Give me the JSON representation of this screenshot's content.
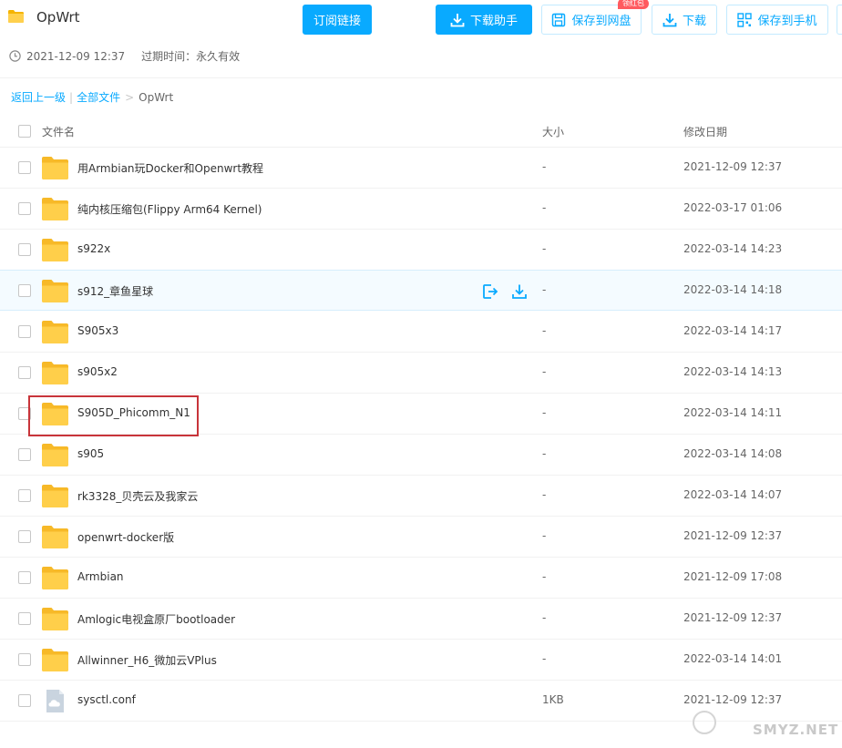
{
  "header": {
    "title": "OpWrt",
    "subscribe_label": "订阅链接",
    "download_helper_label": "下载助手",
    "save_netdisk_label": "保存到网盘",
    "red_packet_badge": "领红包",
    "download_label": "下载",
    "save_phone_label": "保存到手机"
  },
  "meta": {
    "created": "2021-12-09 12:37",
    "expire_label": "过期时间：",
    "expire_value": "永久有效"
  },
  "breadcrumb": {
    "back": "返回上一级",
    "all_files": "全部文件",
    "separator": ">",
    "current": "OpWrt"
  },
  "table": {
    "col_name": "文件名",
    "col_size": "大小",
    "col_date": "修改日期",
    "rows": [
      {
        "name": "用Armbian玩Docker和Openwrt教程",
        "size": "-",
        "date": "2021-12-09 12:37"
      },
      {
        "name": "纯内核压缩包(Flippy Arm64 Kernel)",
        "size": "-",
        "date": "2022-03-17 01:06"
      },
      {
        "name": "s922x",
        "size": "-",
        "date": "2022-03-14 14:23"
      },
      {
        "name": "s912_章鱼星球",
        "size": "-",
        "date": "2022-03-14 14:18"
      },
      {
        "name": "S905x3",
        "size": "-",
        "date": "2022-03-14 14:17"
      },
      {
        "name": "s905x2",
        "size": "-",
        "date": "2022-03-14 14:13"
      },
      {
        "name": "S905D_Phicomm_N1",
        "size": "-",
        "date": "2022-03-14 14:11"
      },
      {
        "name": "s905",
        "size": "-",
        "date": "2022-03-14 14:08"
      },
      {
        "name": "rk3328_贝壳云及我家云",
        "size": "-",
        "date": "2022-03-14 14:07"
      },
      {
        "name": "openwrt-docker版",
        "size": "-",
        "date": "2021-12-09 12:37"
      },
      {
        "name": "Armbian",
        "size": "-",
        "date": "2021-12-09 17:08"
      },
      {
        "name": "Amlogic电视盒原厂bootloader",
        "size": "-",
        "date": "2021-12-09 12:37"
      },
      {
        "name": "Allwinner_H6_微加云VPlus",
        "size": "-",
        "date": "2022-03-14 14:01"
      },
      {
        "name": "sysctl.conf",
        "size": "1KB",
        "date": "2021-12-09 12:37"
      }
    ]
  },
  "watermark": "SMYZ.NET",
  "colors": {
    "accent": "#09aaff",
    "folder": "#ffc93c",
    "highlight": "#c8343a"
  }
}
